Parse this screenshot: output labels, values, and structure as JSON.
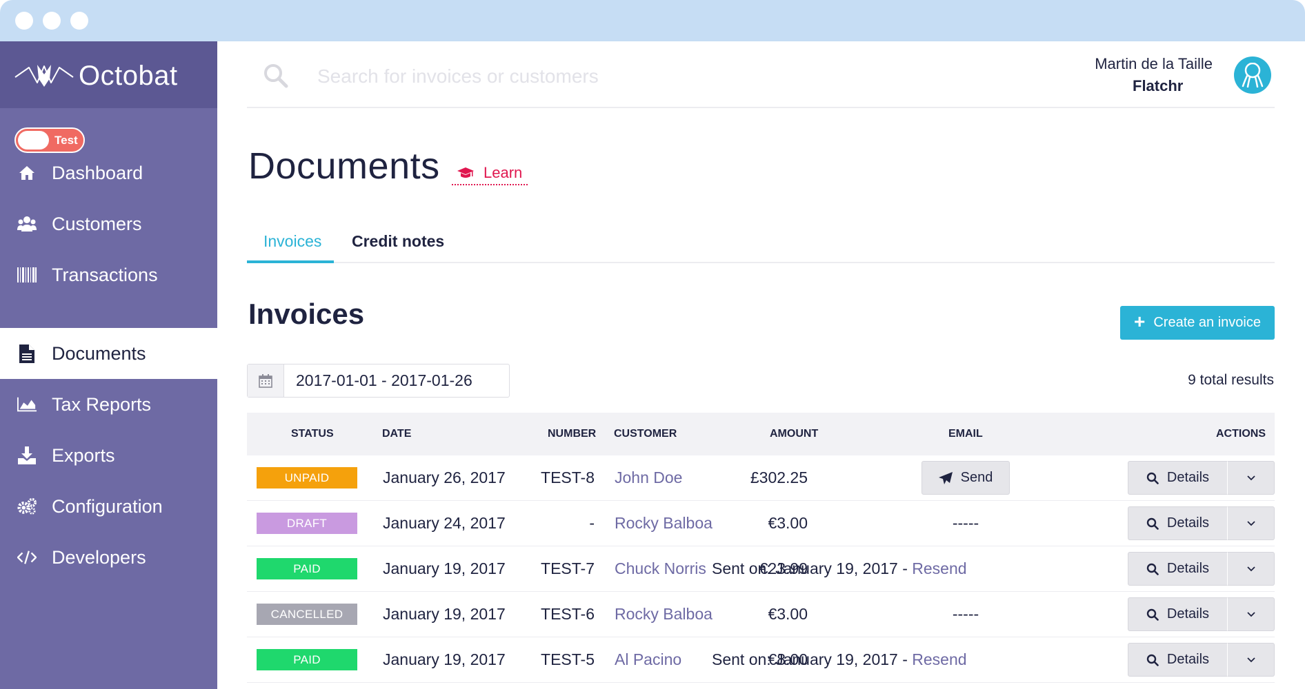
{
  "brand": {
    "name": "Octobat",
    "accent": "#2bb3d6",
    "sidebar_color": "#6e6aa4",
    "learn_color": "#e0174f"
  },
  "mode_toggle": {
    "label": "Test",
    "on": true
  },
  "sidebar": {
    "items": [
      {
        "label": "Dashboard",
        "icon": "home-icon"
      },
      {
        "label": "Customers",
        "icon": "users-icon"
      },
      {
        "label": "Transactions",
        "icon": "barcode-icon"
      },
      {
        "label": "Documents",
        "icon": "document-icon",
        "active": true
      },
      {
        "label": "Tax Reports",
        "icon": "area-chart-icon"
      },
      {
        "label": "Exports",
        "icon": "download-icon"
      },
      {
        "label": "Configuration",
        "icon": "gears-icon"
      },
      {
        "label": "Developers",
        "icon": "code-icon"
      }
    ]
  },
  "search": {
    "placeholder": "Search for invoices or customers",
    "value": ""
  },
  "user": {
    "name": "Martin de la Taille",
    "company": "Flatchr",
    "avatar_icon": "octopus-icon"
  },
  "page": {
    "title": "Documents",
    "learn_label": "Learn"
  },
  "tabs": [
    {
      "label": "Invoices",
      "active": true
    },
    {
      "label": "Credit notes",
      "active": false
    }
  ],
  "invoices": {
    "title": "Invoices",
    "create_label": "Create an invoice",
    "date_range": "2017-01-01 - 2017-01-26",
    "total_results": "9 total results",
    "columns": [
      "STATUS",
      "DATE",
      "NUMBER",
      "CUSTOMER",
      "AMOUNT",
      "EMAIL",
      "ACTIONS"
    ],
    "details_label": "Details",
    "send_label": "Send",
    "rows": [
      {
        "status": "UNPAID",
        "status_color": "#f5a10c",
        "date": "January 26, 2017",
        "number": "TEST-8",
        "customer": "John Doe",
        "amount": "£302.25",
        "email_type": "send",
        "email_text": "",
        "resend": ""
      },
      {
        "status": "DRAFT",
        "status_color": "#c99ae0",
        "date": "January 24, 2017",
        "number": "-",
        "customer": "Rocky Balboa",
        "amount": "€3.00",
        "email_type": "text",
        "email_text": "-----",
        "resend": ""
      },
      {
        "status": "PAID",
        "status_color": "#1fd86d",
        "date": "January 19, 2017",
        "number": "TEST-7",
        "customer": "Chuck Norris",
        "amount": "€23.99",
        "email_type": "text",
        "email_text": "Sent on: January 19, 2017 -",
        "resend": "Resend"
      },
      {
        "status": "CANCELLED",
        "status_color": "#a7a7b2",
        "date": "January 19, 2017",
        "number": "TEST-6",
        "customer": "Rocky Balboa",
        "amount": "€3.00",
        "email_type": "text",
        "email_text": "-----",
        "resend": ""
      },
      {
        "status": "PAID",
        "status_color": "#1fd86d",
        "date": "January 19, 2017",
        "number": "TEST-5",
        "customer": "Al Pacino",
        "amount": "€8.00",
        "email_type": "text",
        "email_text": "Sent on: January 19, 2017 -",
        "resend": "Resend"
      }
    ]
  }
}
